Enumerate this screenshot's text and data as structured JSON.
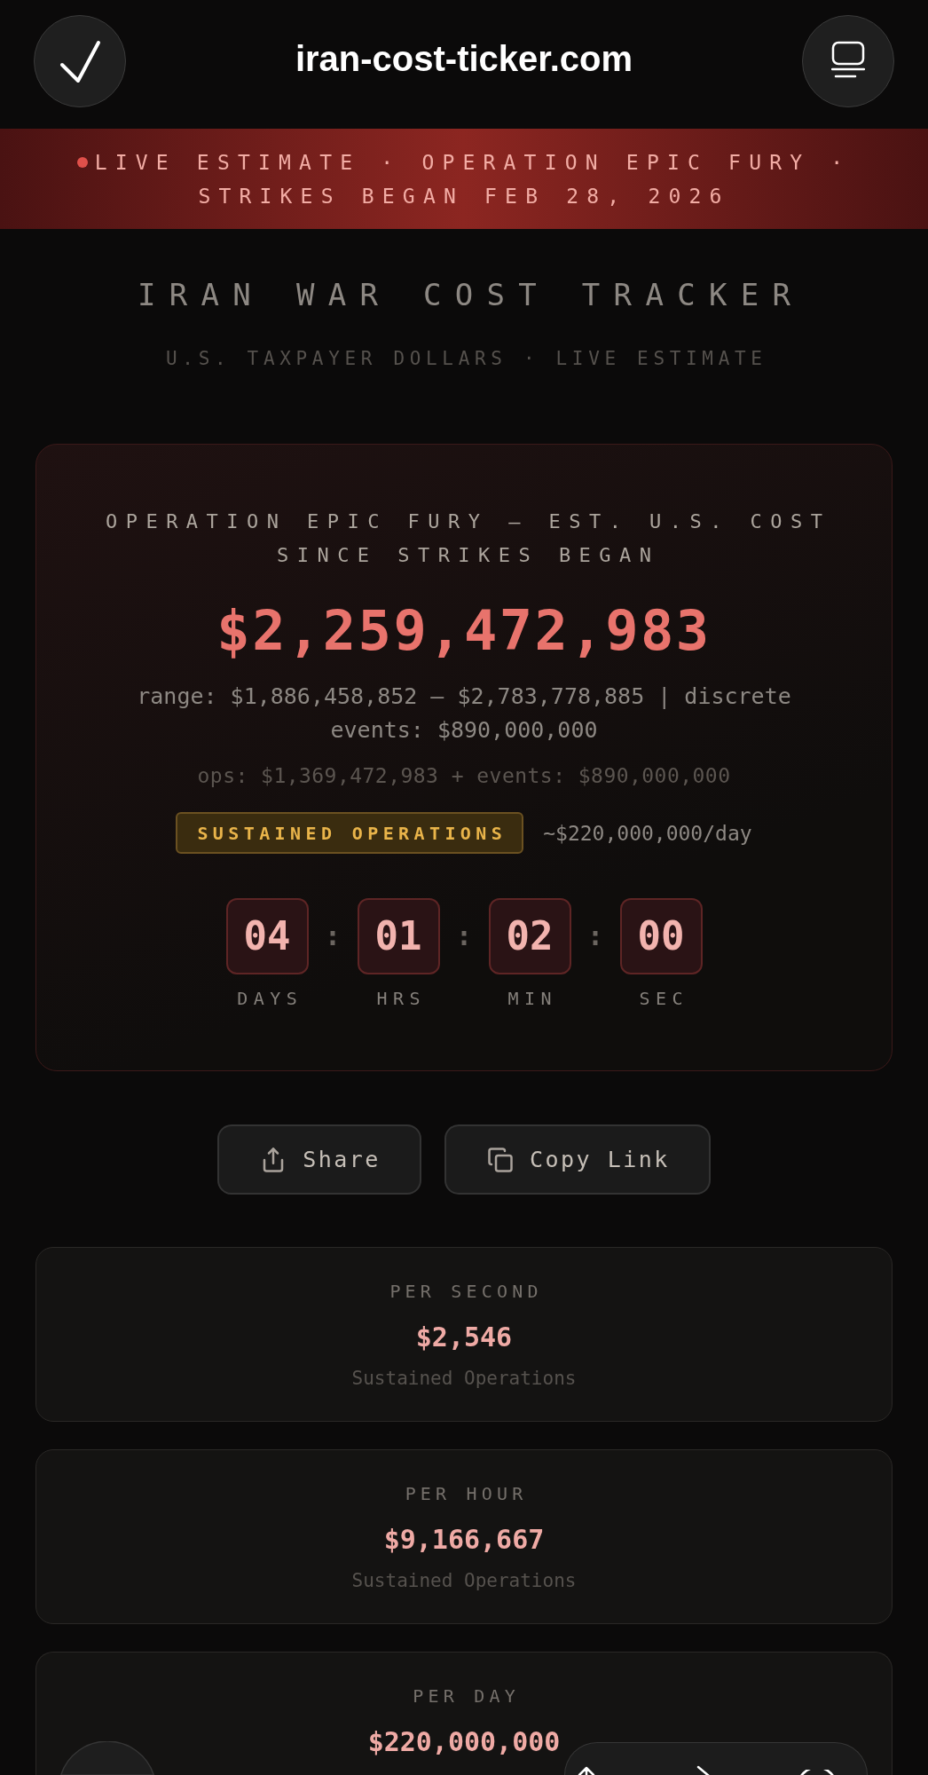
{
  "browser": {
    "url": "iran-cost-ticker.com"
  },
  "banner": {
    "text": "LIVE ESTIMATE · OPERATION EPIC FURY · STRIKES BEGAN FEB 28, 2026"
  },
  "header": {
    "title": "IRAN WAR COST TRACKER",
    "subtitle": "U.S. TAXPAYER DOLLARS · LIVE ESTIMATE"
  },
  "total_card": {
    "heading": "OPERATION EPIC FURY — EST. U.S. COST SINCE STRIKES BEGAN",
    "amount": "$2,259,472,983",
    "range": "range: $1,886,458,852 – $2,783,778,885 | discrete events: $890,000,000",
    "breakdown": "ops: $1,369,472,983 + events: $890,000,000",
    "phase": "SUSTAINED OPERATIONS",
    "daily_rate": "~$220,000,000/day",
    "countdown": [
      {
        "value": "04",
        "unit": "DAYS"
      },
      {
        "value": "01",
        "unit": "HRS"
      },
      {
        "value": "02",
        "unit": "MIN"
      },
      {
        "value": "00",
        "unit": "SEC"
      }
    ],
    "separator": ":"
  },
  "actions": [
    {
      "kind": "share",
      "label": "Share"
    },
    {
      "kind": "copy",
      "label": "Copy Link"
    }
  ],
  "rates": [
    {
      "label": "PER SECOND",
      "value": "$2,546",
      "note": "Sustained Operations"
    },
    {
      "label": "PER HOUR",
      "value": "$9,166,667",
      "note": "Sustained Operations"
    },
    {
      "label": "PER DAY",
      "value": "$220,000,000"
    }
  ]
}
